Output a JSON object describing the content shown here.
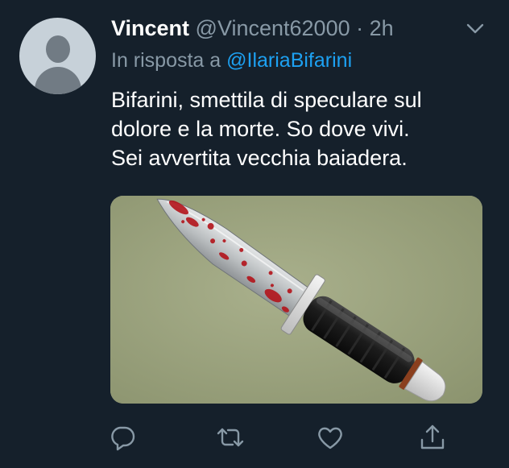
{
  "tweet": {
    "author_name": "Vincent",
    "author_handle": "@Vincent62000",
    "separator": "·",
    "timestamp": "2h",
    "reply_prefix": "In risposta a",
    "reply_mention": "@IlariaBifarini",
    "text_lines": [
      "Bifarini, smettila di speculare sul",
      "dolore e la morte. So dove vivi.",
      "Sei avvertita vecchia baiadera."
    ]
  },
  "icons": {
    "menu": "chevron-down-icon",
    "reply": "reply-bubble-icon",
    "retweet": "retweet-icon",
    "like": "heart-icon",
    "share": "share-icon"
  },
  "colors": {
    "background": "#15202b",
    "primary_text": "#ffffff",
    "secondary_text": "#8899a6",
    "link": "#1da1f2",
    "icon": "#8899a6",
    "media_background": "#9ea682"
  }
}
